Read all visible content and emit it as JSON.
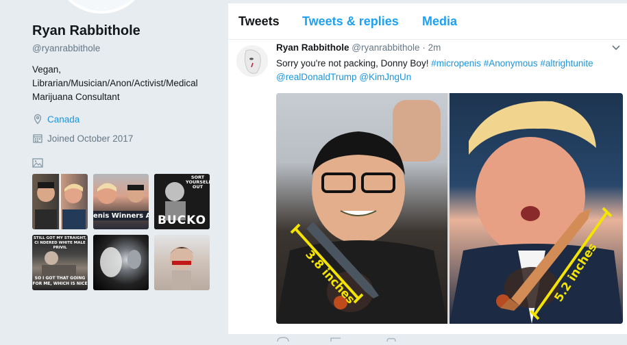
{
  "profile": {
    "name": "Ryan Rabbithole",
    "handle": "@ryanrabbithole",
    "bio": "Vegan, Librarian/Musician/Anon/Activist/Medical Marijuana Consultant",
    "location": "Canada",
    "joined": "Joined October 2017",
    "media_thumbnails": [
      {
        "caption": ""
      },
      {
        "caption": "enis Winners Anno"
      },
      {
        "caption_lines": [
          "SORT",
          "YOURSELF",
          "OUT"
        ],
        "caption_big": "BUCKO"
      },
      {
        "caption_top": "STILL GOT MY STRAIGHT, CI NDERED WHITE MALE PRIVIL",
        "caption_bottom": "SO I GOT THAT GOING FOR ME, WHICH IS NICE"
      },
      {
        "caption": ""
      },
      {
        "caption": ""
      }
    ]
  },
  "tabs": [
    "Tweets",
    "Tweets & replies",
    "Media"
  ],
  "tweet": {
    "author": "Ryan Rabbithole",
    "handle": "@ryanrabbithole",
    "time": "2m",
    "text": "Sorry you're not packing, Donny Boy!",
    "hashtags": [
      "#micropenis",
      "#Anonymous",
      "#altrightunite"
    ],
    "mentions": [
      "@realDonaldTrump",
      "@KimJngUn"
    ],
    "image": {
      "left_label": "3.8 inches",
      "right_label": "5.2 inches"
    }
  },
  "colors": {
    "link": "#1b95e0",
    "background": "#e6ecf0",
    "measure": "#f5e400"
  }
}
